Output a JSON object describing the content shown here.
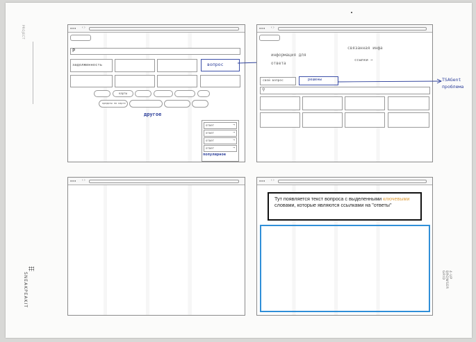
{
  "sheet": {
    "side_top": "PROJECT",
    "brand": "SNEAKPEAKIT",
    "grid_label": "4-UP BROWSER GRID"
  },
  "frame1": {
    "search_letter": "P",
    "cat_first": "задолженность",
    "question_btn": "вопрос",
    "pill_1": "карты",
    "pill_2": "кредиты по карте",
    "other_btn": "другое",
    "answers": [
      "ответ",
      "ответ",
      "ответ",
      "ответ"
    ],
    "popular": "популярное"
  },
  "frame2": {
    "info": "информация для ответа",
    "linked": "связанная инфа",
    "links": "ссылки →",
    "ask_btn": "свой вопрос",
    "solve_btn": "решены",
    "note": "TSAGent проблема"
  },
  "frame4": {
    "text_before": "Тут появляется текст вопроса с выделенными ",
    "highlight": "ключевыми",
    "text_after": " словами, которые являются ссылками на \"ответы\""
  },
  "colors": {
    "blue_box": "#2f8fd8",
    "highlight": "#e0a040",
    "ink": "#2c3f9a"
  }
}
